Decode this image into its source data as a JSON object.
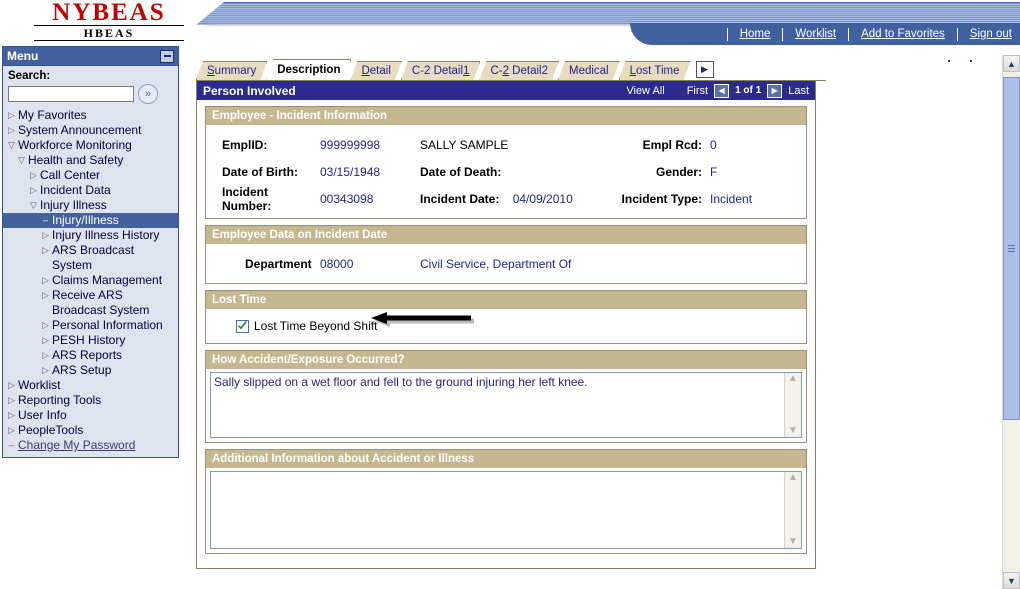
{
  "header": {
    "logo_main": "NYBEAS",
    "logo_sub": "HBEAS",
    "nav": [
      {
        "label": "Home",
        "icon": "home-link"
      },
      {
        "label": "Worklist",
        "icon": "worklist-link"
      },
      {
        "label": "Add to Favorites",
        "icon": "favorites-link"
      },
      {
        "label": "Sign out",
        "icon": "signout-link"
      }
    ]
  },
  "sidebar": {
    "title": "Menu",
    "minimize_icon": "minimize-icon",
    "search_label": "Search:",
    "search_value": "",
    "search_placeholder": "",
    "search_go_icon": "double-chevron-right-icon",
    "items": [
      {
        "label": "My Favorites",
        "marker": "▷",
        "level": 0,
        "state": "collapsed"
      },
      {
        "label": "System Announcement",
        "marker": "▷",
        "level": 0,
        "state": "collapsed"
      },
      {
        "label": "Workforce Monitoring",
        "marker": "▽",
        "level": 0,
        "state": "expanded"
      },
      {
        "label": "Health and Safety",
        "marker": "▽",
        "level": 1,
        "state": "expanded"
      },
      {
        "label": "Call Center",
        "marker": "▷",
        "level": 2,
        "state": "collapsed"
      },
      {
        "label": "Incident Data",
        "marker": "▷",
        "level": 2,
        "state": "collapsed"
      },
      {
        "label": "Injury Illness",
        "marker": "▽",
        "level": 2,
        "state": "expanded"
      },
      {
        "label": "Injury/Illness",
        "marker": "–",
        "level": 3,
        "state": "selected"
      },
      {
        "label": "Injury Illness History",
        "marker": "▷",
        "level": 3,
        "state": "collapsed"
      },
      {
        "label": "ARS Broadcast System",
        "marker": "▷",
        "level": 3,
        "state": "collapsed"
      },
      {
        "label": "Claims Management",
        "marker": "▷",
        "level": 3,
        "state": "collapsed"
      },
      {
        "label": "Receive ARS Broadcast System",
        "marker": "▷",
        "level": 3,
        "state": "collapsed"
      },
      {
        "label": "Personal Information",
        "marker": "▷",
        "level": 3,
        "state": "collapsed"
      },
      {
        "label": "PESH History",
        "marker": "▷",
        "level": 3,
        "state": "collapsed"
      },
      {
        "label": "ARS Reports",
        "marker": "▷",
        "level": 3,
        "state": "collapsed"
      },
      {
        "label": "ARS Setup",
        "marker": "▷",
        "level": 3,
        "state": "collapsed"
      },
      {
        "label": "Worklist",
        "marker": "▷",
        "level": 0,
        "state": "collapsed"
      },
      {
        "label": "Reporting Tools",
        "marker": "▷",
        "level": 0,
        "state": "collapsed"
      },
      {
        "label": "User Info",
        "marker": "▷",
        "level": 0,
        "state": "collapsed"
      },
      {
        "label": "PeopleTools",
        "marker": "▷",
        "level": 0,
        "state": "collapsed"
      },
      {
        "label": "Change My Password",
        "marker": "–",
        "level": 0,
        "state": "link"
      }
    ]
  },
  "tabs": {
    "next_icon": "next-tabs-arrow-icon",
    "items": [
      {
        "label": "Summary",
        "accel": "S",
        "active": false
      },
      {
        "label": "Description",
        "accel": "",
        "active": true
      },
      {
        "label": "Detail",
        "accel": "D",
        "active": false
      },
      {
        "label": "C-2 Detail1",
        "accel": "1",
        "active": false
      },
      {
        "label": "C-2 Detail2",
        "accel": "2",
        "active": false
      },
      {
        "label": "Medical",
        "accel": "",
        "active": false
      },
      {
        "label": "Lost Time",
        "accel": "L",
        "active": false
      }
    ]
  },
  "group": {
    "title": "Person Involved",
    "view_all": "View All",
    "first": "First",
    "last": "Last",
    "counter": "1 of 1",
    "prev_icon": "previous-row-arrow-icon",
    "next_icon": "next-row-arrow-icon"
  },
  "employee_incident": {
    "title": "Employee - Incident Information",
    "emplid_label": "EmplID:",
    "emplid_value": "999999998",
    "name_value": "SALLY SAMPLE",
    "empl_rcd_label": "Empl Rcd:",
    "empl_rcd_value": "0",
    "dob_label": "Date of Birth:",
    "dob_value": "03/15/1948",
    "dod_label": "Date of Death:",
    "dod_value": "",
    "gender_label": "Gender:",
    "gender_value": "F",
    "incident_number_label": "Incident Number:",
    "incident_number_value": "00343098",
    "incident_date_label": "Incident Date:",
    "incident_date_value": "04/09/2010",
    "incident_type_label": "Incident Type:",
    "incident_type_value": "Incident"
  },
  "employee_data": {
    "title": "Employee Data on Incident Date",
    "department_label": "Department",
    "department_code": "08000",
    "department_name": "Civil Service, Department Of"
  },
  "lost_time": {
    "title": "Lost Time",
    "checkbox_label": "Lost Time Beyond Shift",
    "checked": true,
    "annotation_icon": "left-pointing-arrow-annotation"
  },
  "how_occurred": {
    "title": "How Accident/Exposure Occurred?",
    "value": "Sally slipped on a wet floor and fell to the ground injuring her left knee.",
    "scroll_up_icon": "scroll-up-arrow-icon",
    "scroll_down_icon": "scroll-down-arrow-icon"
  },
  "additional_info": {
    "title": "Additional Information about Accident or Illness",
    "value": "",
    "scroll_up_icon": "scroll-up-arrow-icon",
    "scroll_down_icon": "scroll-down-arrow-icon"
  },
  "scrollbar": {
    "up_icon": "scroll-up-arrow-icon",
    "down_icon": "scroll-down-arrow-icon"
  },
  "colors": {
    "nav_blue": "#40619e",
    "group_header": "#2b2b8f",
    "section_header": "#c5b790",
    "tab_inactive": "#e8dcc0",
    "logo_red": "#c00000"
  }
}
